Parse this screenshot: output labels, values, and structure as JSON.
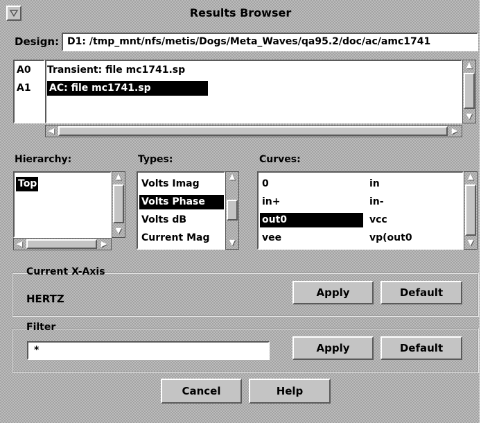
{
  "window": {
    "title": "Results Browser",
    "menu_icon": "menu-triangle-icon"
  },
  "design": {
    "label": "Design:",
    "value": "D1: /tmp_mnt/nfs/metis/Dogs/Meta_Waves/qa95.2/doc/ac/amc1741"
  },
  "results": {
    "items": [
      {
        "id": "A0",
        "text": "Transient: file  mc1741.sp",
        "selected": false
      },
      {
        "id": "A1",
        "text": "AC: file  mc1741.sp",
        "selected": true
      }
    ]
  },
  "hierarchy": {
    "label": "Hierarchy:",
    "items": [
      {
        "text": "Top",
        "selected": true
      }
    ]
  },
  "types": {
    "label": "Types:",
    "items": [
      {
        "text": "Volts Imag",
        "selected": false
      },
      {
        "text": "Volts Phase",
        "selected": true
      },
      {
        "text": "Volts dB",
        "selected": false
      },
      {
        "text": "Current Mag",
        "selected": false
      }
    ]
  },
  "curves": {
    "label": "Curves:",
    "items": [
      {
        "left": "0",
        "right": "in",
        "selected": false
      },
      {
        "left": "in+",
        "right": "in-",
        "selected": false
      },
      {
        "left": "out0",
        "right": "vcc",
        "selected": true
      },
      {
        "left": "vee",
        "right": "vp(out0",
        "selected": false
      }
    ]
  },
  "xaxis": {
    "legend": "Current X-Axis",
    "value": "HERTZ",
    "apply": "Apply",
    "default": "Default"
  },
  "filter": {
    "legend": "Filter",
    "value": "*",
    "apply": "Apply",
    "default": "Default"
  },
  "footer": {
    "cancel": "Cancel",
    "help": "Help"
  }
}
